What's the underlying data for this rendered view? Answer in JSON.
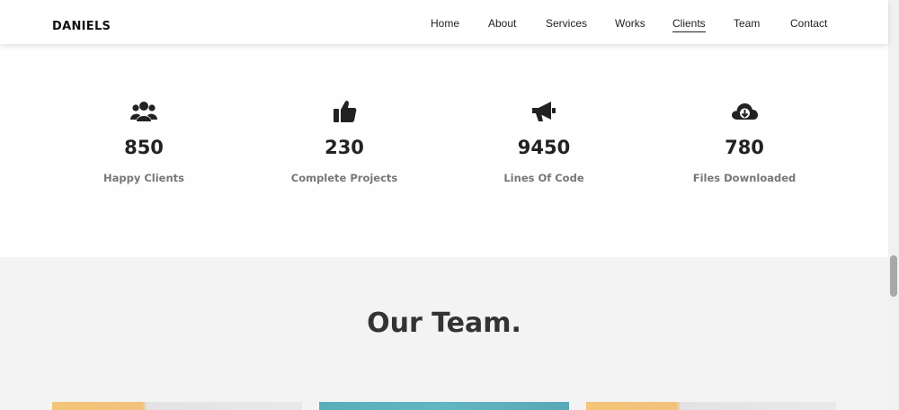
{
  "navbar": {
    "brand": "DANIELS",
    "links": [
      {
        "label": "Home"
      },
      {
        "label": "About"
      },
      {
        "label": "Services"
      },
      {
        "label": "Works"
      },
      {
        "label": "Clients",
        "active": true
      },
      {
        "label": "Team"
      },
      {
        "label": "Contact"
      }
    ]
  },
  "stats": [
    {
      "icon": "users-icon",
      "number": "850",
      "label": "Happy Clients"
    },
    {
      "icon": "thumbs-up-icon",
      "number": "230",
      "label": "Complete Projects"
    },
    {
      "icon": "megaphone-icon",
      "number": "9450",
      "label": "Lines Of Code"
    },
    {
      "icon": "cloud-download-icon",
      "number": "780",
      "label": "Files Downloaded"
    }
  ],
  "team": {
    "title": "Our Team."
  },
  "colors": {
    "text_dark": "#222222",
    "text_muted": "#777777",
    "section_bg": "#f4f3f4",
    "card_yellow": "#f0c27b",
    "card_teal": "#62b5c3"
  }
}
